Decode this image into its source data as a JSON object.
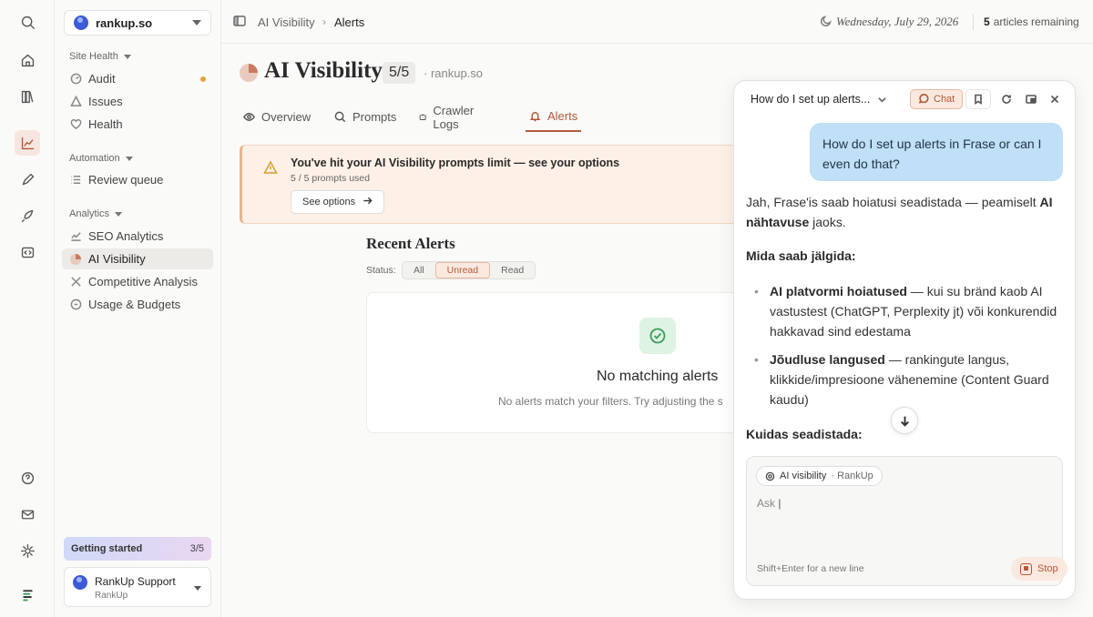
{
  "rail": {
    "icons": [
      "search-icon",
      "home-icon",
      "library-icon",
      "chart-icon",
      "pen-icon",
      "rocket-icon",
      "code-icon",
      "help-icon",
      "mail-icon",
      "gear-icon",
      "logo-icon"
    ]
  },
  "sidebar": {
    "workspace": "rankup.so",
    "sections": {
      "site_health": "Site Health",
      "automation": "Automation",
      "analytics": "Analytics"
    },
    "items": {
      "audit": "Audit",
      "issues": "Issues",
      "health": "Health",
      "review_queue": "Review queue",
      "seo_analytics": "SEO Analytics",
      "ai_visibility": "AI Visibility",
      "competitive_analysis": "Competitive Analysis",
      "usage_budgets": "Usage & Budgets"
    },
    "getting_started": {
      "label": "Getting started",
      "count": "3/5"
    },
    "support": {
      "name": "RankUp Support",
      "org": "RankUp"
    }
  },
  "topbar": {
    "breadcrumb_parent": "AI Visibility",
    "breadcrumb_current": "Alerts",
    "date": "Wednesday, July 29, 2026",
    "articles_count": "5",
    "articles_label": "articles remaining"
  },
  "page": {
    "title": "AI Visibility",
    "score": "5/5",
    "site": "· rankup.so",
    "tabs": {
      "overview": "Overview",
      "prompts": "Prompts",
      "crawler_logs": "Crawler Logs",
      "alerts": "Alerts"
    },
    "limit_banner": {
      "title": "You've hit your AI Visibility prompts limit — see your options",
      "subtitle": "5 / 5 prompts used",
      "button": "See options"
    },
    "recent_alerts": "Recent Alerts",
    "status_label": "Status:",
    "filters": {
      "all": "All",
      "unread": "Unread",
      "read": "Read"
    },
    "empty_title": "No matching alerts",
    "empty_subtitle": "No alerts match your filters. Try adjusting the s"
  },
  "chat": {
    "title": "How do I set up alerts...",
    "chat_button": "Chat",
    "user_message": "How do I set up alerts in Frase or can I even do that?",
    "intro_pre": "Jah, Frase'is saab hoiatusi seadistada — peamiselt ",
    "intro_bold": "AI nähtavuse",
    "intro_post": " jaoks.",
    "heading1": "Mida saab jälgida:",
    "bullet1_bold": "AI platvormi hoiatused",
    "bullet1_rest": " — kui su bränd kaob AI vastustest (ChatGPT, Perplexity jt) või konkurendid hakkavad sind edestama",
    "bullet2_bold": "Jõudluse langused",
    "bullet2_rest": " — rankingute langus, klikkide/impresioone vähenemine (Content Guard kaudu)",
    "heading2": "Kuidas seadistada:",
    "composer": {
      "chip_main": "AI visibility",
      "chip_sub": "· RankUp",
      "placeholder": "Ask",
      "hint": "Shift+Enter for a new line",
      "stop": "Stop"
    }
  }
}
